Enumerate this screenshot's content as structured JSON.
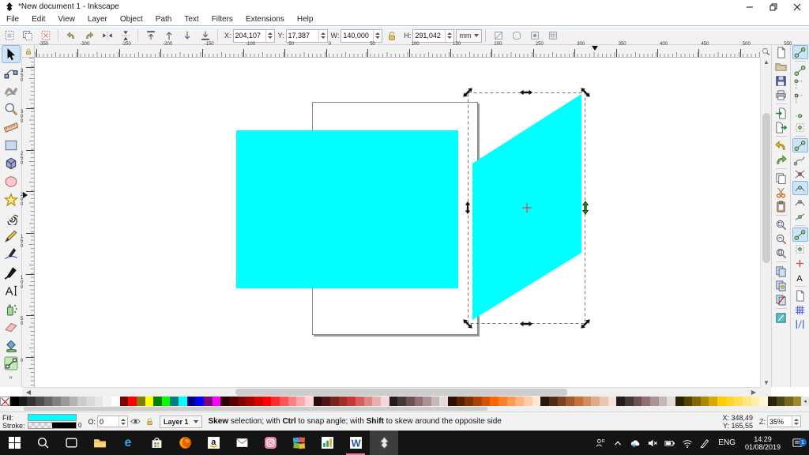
{
  "window": {
    "title": "*New document 1 - Inkscape"
  },
  "menubar": {
    "items": [
      "File",
      "Edit",
      "View",
      "Layer",
      "Object",
      "Path",
      "Text",
      "Filters",
      "Extensions",
      "Help"
    ]
  },
  "toolbar": {
    "select_icons": [
      {
        "name": "select-all-button",
        "glyph": "selall"
      },
      {
        "name": "select-all-layers-button",
        "glyph": "selalllayers"
      },
      {
        "name": "deselect-button",
        "glyph": "deselect"
      }
    ],
    "transform_icons": [
      {
        "name": "rotate-ccw-button",
        "glyph": "rotl"
      },
      {
        "name": "rotate-cw-button",
        "glyph": "rotr"
      },
      {
        "name": "flip-horizontal-button",
        "glyph": "fliph"
      },
      {
        "name": "flip-vertical-button",
        "glyph": "flipv"
      }
    ],
    "z-order_icons": [
      {
        "name": "raise-to-top-button",
        "glyph": "totop"
      },
      {
        "name": "raise-button",
        "glyph": "raise"
      },
      {
        "name": "lower-button",
        "glyph": "lower"
      },
      {
        "name": "lower-to-bottom-button",
        "glyph": "tobottom"
      }
    ],
    "affect_icons": [
      {
        "name": "affect-stroke-toggle",
        "glyph": "affect1"
      },
      {
        "name": "affect-corners-toggle",
        "glyph": "affect2"
      },
      {
        "name": "affect-gradient-toggle",
        "glyph": "affect3"
      },
      {
        "name": "affect-pattern-toggle",
        "glyph": "affect4"
      }
    ],
    "fields": {
      "x_label": "X:",
      "x_value": "204,107",
      "y_label": "Y:",
      "y_value": "17,387",
      "w_label": "W:",
      "w_value": "140,000",
      "h_label": "H:",
      "h_value": "291,042",
      "unit": "mm"
    }
  },
  "toolbox": {
    "overflow_label": "»",
    "tools": [
      {
        "name": "selector-tool",
        "glyph": "selector",
        "active": true
      },
      {
        "name": "node-tool",
        "glyph": "node"
      },
      {
        "name": "tweak-tool",
        "glyph": "tweak"
      },
      {
        "name": "zoom-tool",
        "glyph": "zoomt"
      },
      {
        "name": "measure-tool",
        "glyph": "measure"
      },
      {
        "name": "rectangle-tool",
        "glyph": "rectt"
      },
      {
        "name": "box3d-tool",
        "glyph": "box3d"
      },
      {
        "name": "ellipse-tool",
        "glyph": "ellipset"
      },
      {
        "name": "star-tool",
        "glyph": "start"
      },
      {
        "name": "spiral-tool",
        "glyph": "spiral"
      },
      {
        "name": "pencil-tool",
        "glyph": "pencil"
      },
      {
        "name": "pen-tool",
        "glyph": "pent"
      },
      {
        "name": "calligraphy-tool",
        "glyph": "calli"
      },
      {
        "name": "text-tool",
        "glyph": "textt"
      },
      {
        "name": "spray-tool",
        "glyph": "spray"
      },
      {
        "name": "eraser-tool",
        "glyph": "eraser"
      },
      {
        "name": "bucket-tool",
        "glyph": "bucket"
      },
      {
        "name": "gradient-tool",
        "glyph": "gradient"
      }
    ]
  },
  "rulers": {
    "top_labels": [
      -350,
      -300,
      -250,
      -200,
      -150,
      -100,
      -50,
      0,
      50,
      100,
      150,
      200,
      250,
      300,
      350,
      400,
      450,
      500,
      550
    ],
    "left_labels": [
      350,
      300,
      250,
      200,
      150,
      100,
      50,
      0
    ]
  },
  "canvas": {
    "shape_fill": "#00ffff",
    "selection_handle_color": "#111111",
    "snapped_handle_color": "#1e8c1e",
    "rotation_center_color": "#e04040"
  },
  "commandbar": {
    "items": [
      {
        "name": "new-document-button",
        "glyph": "page"
      },
      {
        "name": "open-document-button",
        "glyph": "folder"
      },
      {
        "name": "save-button",
        "glyph": "floppy"
      },
      {
        "name": "print-button",
        "glyph": "printer"
      },
      "sep",
      {
        "name": "import-button",
        "glyph": "import"
      },
      {
        "name": "export-button",
        "glyph": "export"
      },
      "sep",
      {
        "name": "undo-button",
        "glyph": "undo"
      },
      {
        "name": "redo-button",
        "glyph": "redo"
      },
      "sep",
      {
        "name": "copy-button",
        "glyph": "copy"
      },
      {
        "name": "cut-button",
        "glyph": "scissors"
      },
      {
        "name": "paste-button",
        "glyph": "clipboard"
      },
      "sep",
      {
        "name": "zoom-to-selection-button",
        "glyph": "zoomsel"
      },
      {
        "name": "zoom-to-drawing-button",
        "glyph": "zoomdraw"
      },
      {
        "name": "zoom-to-page-button",
        "glyph": "zoompage"
      },
      "sep",
      {
        "name": "duplicate-button",
        "glyph": "copy2"
      },
      {
        "name": "create-clone-button",
        "glyph": "clone"
      },
      {
        "name": "unlink-clone-button",
        "glyph": "unlink"
      },
      "sep",
      {
        "name": "fill-stroke-dialog-button",
        "glyph": "fillstroke"
      }
    ]
  },
  "snapbar": {
    "items": [
      {
        "name": "snap-enable-toggle",
        "glyph": "nodepair",
        "active": true
      },
      "sep",
      {
        "name": "snap-bounding-box-toggle",
        "glyph": "nodepair"
      },
      {
        "name": "snap-bbox-edges-toggle",
        "glyph": "dashededge"
      },
      {
        "name": "snap-bbox-corners-toggle",
        "glyph": "cornern"
      },
      {
        "name": "snap-bbox-edge-midpoints-toggle",
        "glyph": "midpoint"
      },
      {
        "name": "snap-bbox-centers-toggle",
        "glyph": "centerdot"
      },
      "sep",
      {
        "name": "snap-nodes-paths-toggle",
        "glyph": "nodepair",
        "active": true
      },
      {
        "name": "snap-paths-toggle",
        "glyph": "curve"
      },
      {
        "name": "snap-path-intersections-toggle",
        "glyph": "intersect"
      },
      {
        "name": "snap-cusp-nodes-toggle",
        "glyph": "curvenode",
        "active": true
      },
      {
        "name": "snap-smooth-nodes-toggle",
        "glyph": "smooth"
      },
      {
        "name": "snap-line-midpoints-toggle",
        "glyph": "midline"
      },
      "sep",
      {
        "name": "snap-others-toggle",
        "glyph": "nodepair",
        "active": true
      },
      {
        "name": "snap-object-centers-toggle",
        "glyph": "centerdot"
      },
      {
        "name": "snap-rotation-centers-toggle",
        "glyph": "pluscorner"
      },
      {
        "name": "snap-text-anchors-toggle",
        "glyph": "texta"
      },
      "sep",
      {
        "name": "snap-page-border-toggle",
        "glyph": "page"
      },
      {
        "name": "snap-grid-toggle",
        "glyph": "grid"
      },
      {
        "name": "snap-guides-toggle",
        "glyph": "guides"
      }
    ]
  },
  "palette": {
    "colors": [
      "#000000",
      "#1a1a1a",
      "#333333",
      "#4d4d4d",
      "#666666",
      "#808080",
      "#999999",
      "#b3b3b3",
      "#cccccc",
      "#d9d9d9",
      "#e6e6e6",
      "#f2f2f2",
      "#ffffff",
      "#800000",
      "#ff0000",
      "#808000",
      "#ffff00",
      "#008000",
      "#00ff00",
      "#008080",
      "#00ffff",
      "#000080",
      "#0000ff",
      "#800080",
      "#ff00ff",
      "#2b0000",
      "#550000",
      "#800000",
      "#aa0000",
      "#d40000",
      "#ff0000",
      "#ff2a2a",
      "#ff5555",
      "#ff8080",
      "#ffaaaa",
      "#ffd5d5",
      "#280b0b",
      "#501616",
      "#782121",
      "#a02c2c",
      "#c83737",
      "#d35f5f",
      "#de8787",
      "#e9afaf",
      "#f4d7d7",
      "#241c1c",
      "#483737",
      "#6c5353",
      "#916f6f",
      "#ac9393",
      "#c8b7b7",
      "#e3dbdb",
      "#2b1100",
      "#552200",
      "#803300",
      "#aa4400",
      "#d45500",
      "#ff6600",
      "#ff7f2a",
      "#ff9955",
      "#ffb380",
      "#ffccaa",
      "#ffe6d5",
      "#28170b",
      "#502d16",
      "#784421",
      "#a05a2c",
      "#c87137",
      "#d38d5f",
      "#deaa87",
      "#e9c6af",
      "#f4e3d7",
      "#241c1c",
      "#483737",
      "#6c5353",
      "#916f6f",
      "#ac9393",
      "#c8b7b7",
      "#e3dbdb",
      "#2b2200",
      "#554400",
      "#806600",
      "#aa8800",
      "#d4aa00",
      "#ffcc00",
      "#ffd42a",
      "#ffdd55",
      "#ffe680",
      "#ffeeaa",
      "#fff6d5",
      "#28220b",
      "#504516",
      "#786721",
      "#a08a2c"
    ],
    "scroll_left_label": "◂"
  },
  "statusbar": {
    "fill_label": "Fill:",
    "stroke_label": "Stroke:",
    "fill_color": "#00ffff",
    "stroke_width": "0",
    "opacity_label": "O:",
    "opacity_value": "0",
    "layer_name": "Layer 1",
    "message_parts": [
      {
        "text": "Skew",
        "bold": true
      },
      {
        "text": " selection; with ",
        "bold": false
      },
      {
        "text": "Ctrl",
        "bold": true
      },
      {
        "text": " to snap angle; with ",
        "bold": false
      },
      {
        "text": "Shift",
        "bold": true
      },
      {
        "text": " to skew around the opposite side",
        "bold": false
      }
    ],
    "pointer": {
      "x_label": "X:",
      "x_value": "348,49",
      "y_label": "Y:",
      "y_value": "165,55"
    },
    "zoom_label": "Z:",
    "zoom_value": "35%"
  },
  "taskbar": {
    "apps": [
      {
        "name": "start-button",
        "glyph": "start"
      },
      {
        "name": "search-button",
        "glyph": "search"
      },
      {
        "name": "task-view-button",
        "glyph": "taskview"
      },
      {
        "name": "file-explorer-icon",
        "glyph": "explorer"
      },
      {
        "name": "edge-icon",
        "glyph": "edge"
      },
      {
        "name": "store-icon",
        "glyph": "store"
      },
      {
        "name": "firefox-icon",
        "glyph": "firefox"
      },
      {
        "name": "amazon-icon",
        "glyph": "amazon"
      },
      {
        "name": "mail-icon",
        "glyph": "mail"
      },
      {
        "name": "instagram-icon",
        "glyph": "instagram"
      },
      {
        "name": "photos-app-icon",
        "glyph": "photos"
      },
      {
        "name": "chart-app-icon",
        "glyph": "chartapp"
      },
      {
        "name": "word-icon",
        "glyph": "word",
        "running": true
      },
      {
        "name": "inkscape-icon",
        "glyph": "inkscape",
        "active": true
      }
    ],
    "tray": {
      "icons": [
        {
          "name": "people-icon",
          "glyph": "people"
        },
        {
          "name": "chevron-up-icon",
          "glyph": "chevup"
        },
        {
          "name": "onedrive-icon",
          "glyph": "onedrive"
        },
        {
          "name": "volume-muted-icon",
          "glyph": "volmute"
        },
        {
          "name": "battery-icon",
          "glyph": "battery"
        },
        {
          "name": "network-icon",
          "glyph": "network"
        },
        {
          "name": "pen-icon",
          "glyph": "pen"
        }
      ],
      "language": "ENG",
      "time": "14:29",
      "date": "01/08/2019",
      "notification_count": "1"
    }
  }
}
